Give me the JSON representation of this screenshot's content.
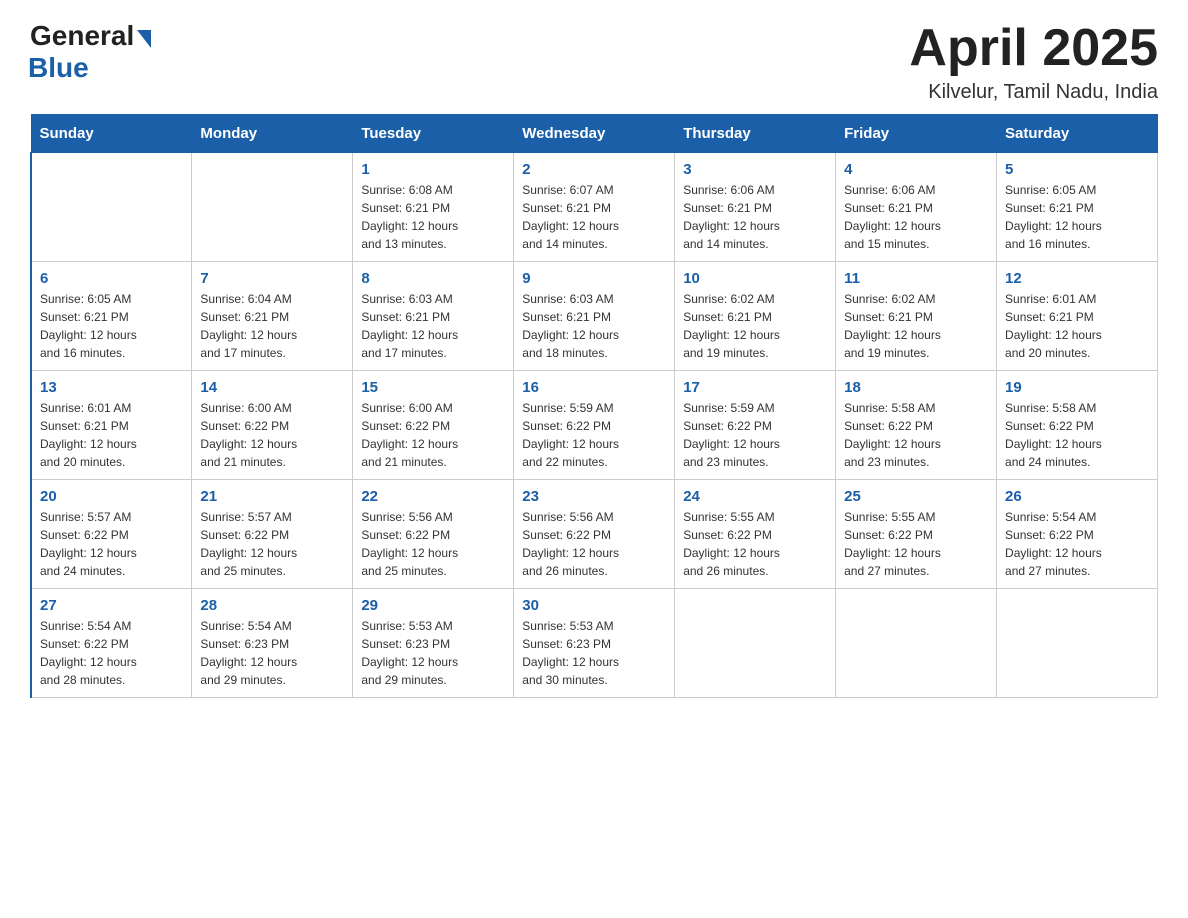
{
  "logo": {
    "general": "General",
    "blue": "Blue"
  },
  "title": "April 2025",
  "subtitle": "Kilvelur, Tamil Nadu, India",
  "days_of_week": [
    "Sunday",
    "Monday",
    "Tuesday",
    "Wednesday",
    "Thursday",
    "Friday",
    "Saturday"
  ],
  "weeks": [
    [
      {
        "day": "",
        "info": ""
      },
      {
        "day": "",
        "info": ""
      },
      {
        "day": "1",
        "info": "Sunrise: 6:08 AM\nSunset: 6:21 PM\nDaylight: 12 hours\nand 13 minutes."
      },
      {
        "day": "2",
        "info": "Sunrise: 6:07 AM\nSunset: 6:21 PM\nDaylight: 12 hours\nand 14 minutes."
      },
      {
        "day": "3",
        "info": "Sunrise: 6:06 AM\nSunset: 6:21 PM\nDaylight: 12 hours\nand 14 minutes."
      },
      {
        "day": "4",
        "info": "Sunrise: 6:06 AM\nSunset: 6:21 PM\nDaylight: 12 hours\nand 15 minutes."
      },
      {
        "day": "5",
        "info": "Sunrise: 6:05 AM\nSunset: 6:21 PM\nDaylight: 12 hours\nand 16 minutes."
      }
    ],
    [
      {
        "day": "6",
        "info": "Sunrise: 6:05 AM\nSunset: 6:21 PM\nDaylight: 12 hours\nand 16 minutes."
      },
      {
        "day": "7",
        "info": "Sunrise: 6:04 AM\nSunset: 6:21 PM\nDaylight: 12 hours\nand 17 minutes."
      },
      {
        "day": "8",
        "info": "Sunrise: 6:03 AM\nSunset: 6:21 PM\nDaylight: 12 hours\nand 17 minutes."
      },
      {
        "day": "9",
        "info": "Sunrise: 6:03 AM\nSunset: 6:21 PM\nDaylight: 12 hours\nand 18 minutes."
      },
      {
        "day": "10",
        "info": "Sunrise: 6:02 AM\nSunset: 6:21 PM\nDaylight: 12 hours\nand 19 minutes."
      },
      {
        "day": "11",
        "info": "Sunrise: 6:02 AM\nSunset: 6:21 PM\nDaylight: 12 hours\nand 19 minutes."
      },
      {
        "day": "12",
        "info": "Sunrise: 6:01 AM\nSunset: 6:21 PM\nDaylight: 12 hours\nand 20 minutes."
      }
    ],
    [
      {
        "day": "13",
        "info": "Sunrise: 6:01 AM\nSunset: 6:21 PM\nDaylight: 12 hours\nand 20 minutes."
      },
      {
        "day": "14",
        "info": "Sunrise: 6:00 AM\nSunset: 6:22 PM\nDaylight: 12 hours\nand 21 minutes."
      },
      {
        "day": "15",
        "info": "Sunrise: 6:00 AM\nSunset: 6:22 PM\nDaylight: 12 hours\nand 21 minutes."
      },
      {
        "day": "16",
        "info": "Sunrise: 5:59 AM\nSunset: 6:22 PM\nDaylight: 12 hours\nand 22 minutes."
      },
      {
        "day": "17",
        "info": "Sunrise: 5:59 AM\nSunset: 6:22 PM\nDaylight: 12 hours\nand 23 minutes."
      },
      {
        "day": "18",
        "info": "Sunrise: 5:58 AM\nSunset: 6:22 PM\nDaylight: 12 hours\nand 23 minutes."
      },
      {
        "day": "19",
        "info": "Sunrise: 5:58 AM\nSunset: 6:22 PM\nDaylight: 12 hours\nand 24 minutes."
      }
    ],
    [
      {
        "day": "20",
        "info": "Sunrise: 5:57 AM\nSunset: 6:22 PM\nDaylight: 12 hours\nand 24 minutes."
      },
      {
        "day": "21",
        "info": "Sunrise: 5:57 AM\nSunset: 6:22 PM\nDaylight: 12 hours\nand 25 minutes."
      },
      {
        "day": "22",
        "info": "Sunrise: 5:56 AM\nSunset: 6:22 PM\nDaylight: 12 hours\nand 25 minutes."
      },
      {
        "day": "23",
        "info": "Sunrise: 5:56 AM\nSunset: 6:22 PM\nDaylight: 12 hours\nand 26 minutes."
      },
      {
        "day": "24",
        "info": "Sunrise: 5:55 AM\nSunset: 6:22 PM\nDaylight: 12 hours\nand 26 minutes."
      },
      {
        "day": "25",
        "info": "Sunrise: 5:55 AM\nSunset: 6:22 PM\nDaylight: 12 hours\nand 27 minutes."
      },
      {
        "day": "26",
        "info": "Sunrise: 5:54 AM\nSunset: 6:22 PM\nDaylight: 12 hours\nand 27 minutes."
      }
    ],
    [
      {
        "day": "27",
        "info": "Sunrise: 5:54 AM\nSunset: 6:22 PM\nDaylight: 12 hours\nand 28 minutes."
      },
      {
        "day": "28",
        "info": "Sunrise: 5:54 AM\nSunset: 6:23 PM\nDaylight: 12 hours\nand 29 minutes."
      },
      {
        "day": "29",
        "info": "Sunrise: 5:53 AM\nSunset: 6:23 PM\nDaylight: 12 hours\nand 29 minutes."
      },
      {
        "day": "30",
        "info": "Sunrise: 5:53 AM\nSunset: 6:23 PM\nDaylight: 12 hours\nand 30 minutes."
      },
      {
        "day": "",
        "info": ""
      },
      {
        "day": "",
        "info": ""
      },
      {
        "day": "",
        "info": ""
      }
    ]
  ]
}
